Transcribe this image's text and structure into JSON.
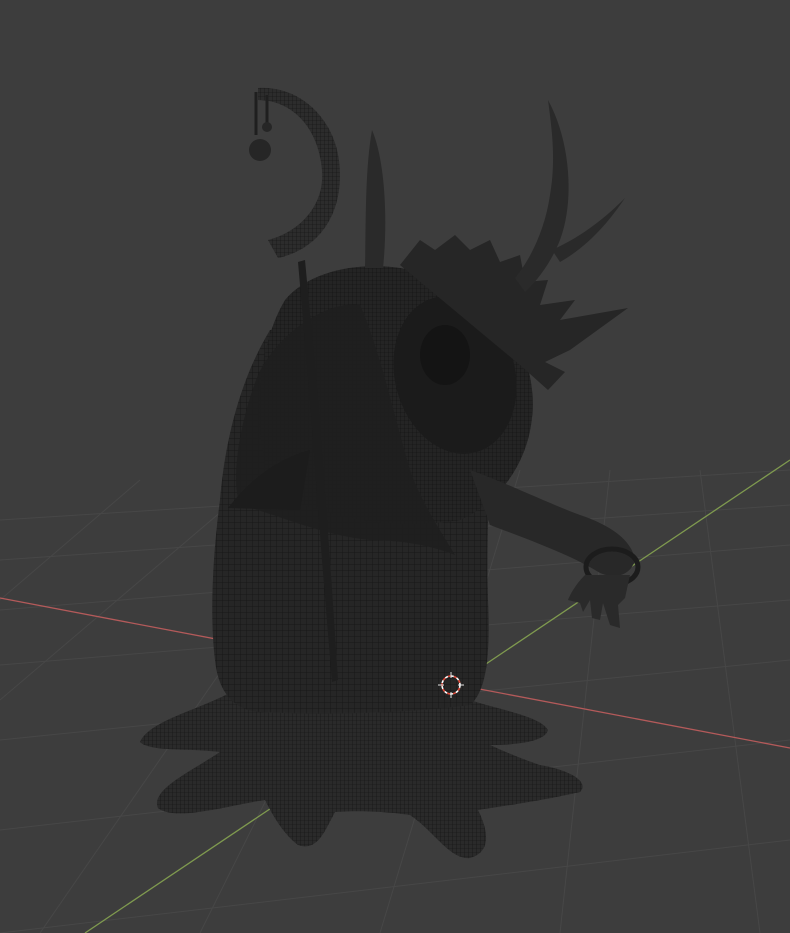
{
  "app": "3D viewport",
  "viewport": {
    "background": "#3d3d3d",
    "grid_color": "#4a4a4a",
    "x_axis_color": "#b45a5a",
    "y_axis_color": "#7f9a4f",
    "model_fill": "#262626",
    "model_wire": "#121212",
    "cursor_color": "#e04a3a"
  },
  "scene": {
    "object": "creature-mesh",
    "display_mode": "wireframe-overlay",
    "icons": [
      "3d-cursor-icon"
    ]
  }
}
